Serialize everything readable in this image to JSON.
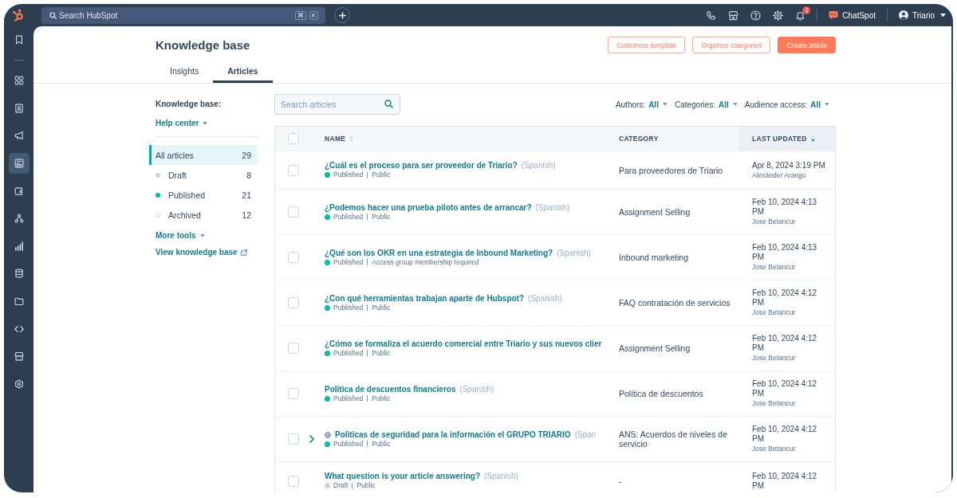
{
  "nav_rail": {
    "items": [
      {
        "selected": false
      },
      {
        "selected": false
      },
      {
        "selected": false
      },
      {
        "selected": false
      },
      {
        "selected": true
      },
      {
        "selected": false
      },
      {
        "selected": false
      },
      {
        "selected": false
      },
      {
        "selected": false
      },
      {
        "selected": false
      },
      {
        "selected": false
      },
      {
        "selected": false
      },
      {
        "selected": false
      }
    ]
  },
  "top_bar": {
    "search": {
      "placeholder": "Search HubSpot"
    },
    "shortcut_keys": [
      "⌘",
      "K"
    ],
    "notification_count": "2",
    "assistant": {
      "label": "ChatSpot"
    },
    "account": {
      "name": "Triario"
    }
  },
  "header": {
    "title": "Knowledge base",
    "buttons": [
      {
        "label": "Customize template",
        "kind": "secondary"
      },
      {
        "label": "Organize categories",
        "kind": "secondary"
      },
      {
        "label": "Create article",
        "kind": "primary"
      }
    ],
    "tabs": [
      {
        "label": "Insights",
        "selected": false
      },
      {
        "label": "Articles",
        "selected": true
      }
    ]
  },
  "sidebar": {
    "heading": "Knowledge base:",
    "selector": "Help center",
    "filters": [
      {
        "label": "All articles",
        "count": "29",
        "selected": true,
        "kind": "plain"
      },
      {
        "label": "Draft",
        "count": "8",
        "selected": false,
        "kind": "dot",
        "color": "#cbd6e2"
      },
      {
        "label": "Published",
        "count": "21",
        "selected": false,
        "kind": "dot",
        "color": "#00bda5"
      },
      {
        "label": "Archived",
        "count": "12",
        "selected": false,
        "kind": "ring",
        "color": "#cbd6e2"
      }
    ],
    "more_tools": "More tools",
    "view_link": "View knowledge base"
  },
  "articles": {
    "search": {
      "placeholder": "Search articles"
    },
    "filters": [
      {
        "label": "Authors:",
        "value": "All"
      },
      {
        "label": "Categories:",
        "value": "All"
      },
      {
        "label": "Audience access:",
        "value": "All"
      }
    ],
    "table": {
      "select_all": {
        "checked": false
      },
      "columns": [
        {
          "label": "NAME",
          "sortable": true,
          "sorted": false
        },
        {
          "label": "CATEGORY",
          "sortable": false,
          "sorted": false
        },
        {
          "label": "LAST UPDATED",
          "sortable": true,
          "sorted": true
        }
      ],
      "rows": [
        {
          "checked": false,
          "expandable": false,
          "multi_language": false,
          "title": "¿Cuál es el proceso para ser proveedor de Triario?",
          "language": "(Spanish)",
          "status": "Published",
          "color": "#00bda5",
          "audience": "Public",
          "category": "Para proveedores de Triario",
          "updated": "Apr 8, 2024 3:19 PM",
          "author": "Alexánder Arango"
        },
        {
          "checked": false,
          "expandable": false,
          "multi_language": false,
          "title": "¿Podemos hacer una prueba piloto antes de arrancar?",
          "language": "(Spanish)",
          "status": "Published",
          "color": "#00bda5",
          "audience": "Public",
          "category": "Assignment Selling",
          "updated": "Feb 10, 2024 4:13 PM",
          "author": "Jose Betancur"
        },
        {
          "checked": false,
          "expandable": false,
          "multi_language": false,
          "title": "¿Qué son los OKR en una estrategia de Inbound Marketing?",
          "language": "(Spanish)",
          "status": "Published",
          "color": "#00bda5",
          "audience": "Access group membership required",
          "category": "Inbound marketing",
          "updated": "Feb 10, 2024 4:13 PM",
          "author": "Jose Betancur"
        },
        {
          "checked": false,
          "expandable": false,
          "multi_language": false,
          "title": "¿Con qué herramientas trabajan aparte de Hubspot?",
          "language": "(Spanish)",
          "status": "Published",
          "color": "#00bda5",
          "audience": "Public",
          "category": "FAQ contratación de servicios",
          "updated": "Feb 10, 2024 4:12 PM",
          "author": "Jose Betancur"
        },
        {
          "checked": false,
          "expandable": false,
          "multi_language": false,
          "title": "¿Cómo se formaliza el acuerdo comercial entre Triario y sus nuevos clier",
          "status": "Published",
          "color": "#00bda5",
          "audience": "Public",
          "category": "Assignment Selling",
          "updated": "Feb 10, 2024 4:12 PM",
          "author": "Jose Betancur"
        },
        {
          "checked": false,
          "expandable": false,
          "multi_language": false,
          "title": "Politica de descuentos financieros",
          "language": "(Spanish)",
          "status": "Published",
          "color": "#00bda5",
          "audience": "Public",
          "category": "Política de descuentos",
          "updated": "Feb 10, 2024 4:12 PM",
          "author": "Jose Betancur"
        },
        {
          "checked": false,
          "expandable": true,
          "multi_language": true,
          "title": "Politicas de seguridad para la información el GRUPO TRIARIO",
          "language": "(Span",
          "status": "Published",
          "color": "#00bda5",
          "audience": "Public",
          "category": "ANS: Acuerdos de niveles de servicio",
          "updated": "Feb 10, 2024 4:12 PM",
          "author": "Jose Betancur"
        },
        {
          "checked": false,
          "expandable": false,
          "multi_language": false,
          "title": "What question is your article answering?",
          "language": "(Spanish)",
          "status": "Draft",
          "color": "#cbd6e2",
          "audience": "Public",
          "category": "-",
          "updated": "Feb 10, 2024 4:12 PM"
        }
      ]
    }
  }
}
